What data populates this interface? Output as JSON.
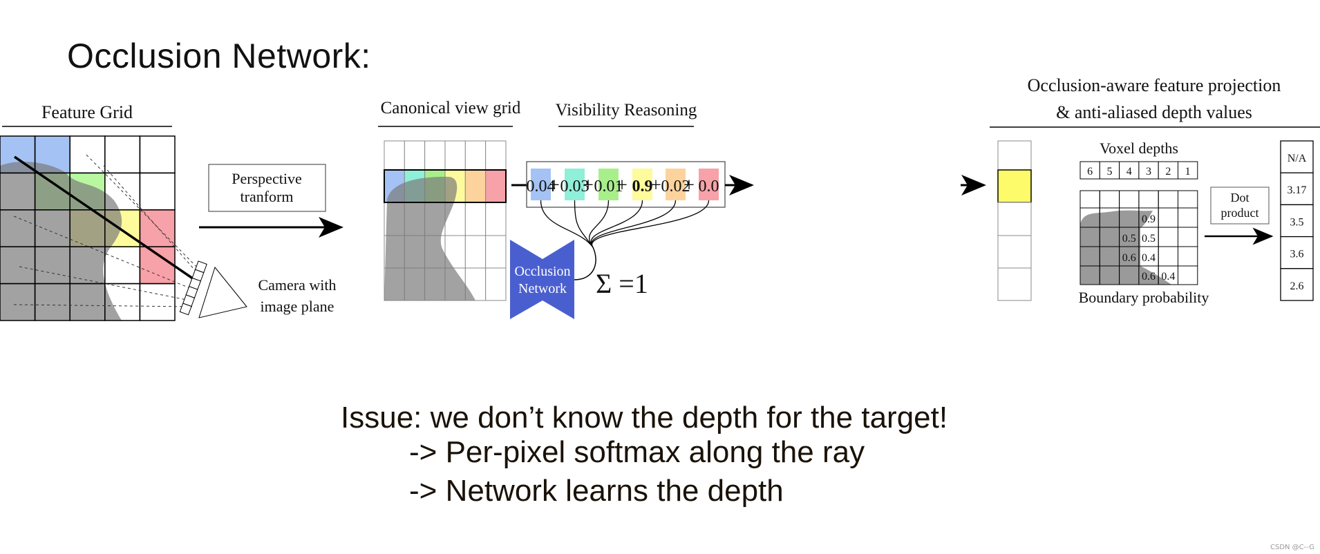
{
  "slide": {
    "title": "Occlusion Network:"
  },
  "diagram": {
    "feature_grid": {
      "title": "Feature Grid"
    },
    "perspective": {
      "line1": "Perspective",
      "line2": "tranform"
    },
    "camera": {
      "line1": "Camera with",
      "line2": "image plane"
    },
    "canonical": {
      "title": "Canonical view grid",
      "row_colors": [
        "#a4c2f4",
        "#8fefd8",
        "#a8ef8c",
        "#fdfb9c",
        "#fcd39c",
        "#f7a1a8"
      ]
    },
    "visibility": {
      "title": "Visibility Reasoning",
      "values": [
        "0.04",
        "0.03",
        "0.01",
        "0.9",
        "0.02",
        "0.0"
      ],
      "operator": "+",
      "sum_label": "Σ =1"
    },
    "network": {
      "line1": "Occlusion",
      "line2": "Network",
      "color": "#4a5fcf"
    },
    "projection": {
      "title_line1": "Occlusion-aware feature projection",
      "title_line2": "& anti-aliased depth values",
      "voxel_label": "Voxel depths",
      "voxel_depths": [
        "6",
        "5",
        "4",
        "3",
        "2",
        "1"
      ],
      "boundary_label": "Boundary probability",
      "probabilities": [
        [
          "",
          "",
          "",
          "",
          "",
          ""
        ],
        [
          "",
          "",
          "",
          "0.9",
          "",
          ""
        ],
        [
          "",
          "",
          "0.5",
          "0.5",
          "",
          ""
        ],
        [
          "",
          "",
          "0.6",
          "0.4",
          "",
          ""
        ],
        [
          "",
          "",
          "",
          "0.6",
          "0.4",
          ""
        ]
      ],
      "dot_line1": "Dot",
      "dot_line2": "product",
      "depth_values": [
        "N/A",
        "3.17",
        "3.5",
        "3.6",
        "2.6"
      ]
    }
  },
  "issue": {
    "line1": "Issue: we don’t know the depth for the target!",
    "line2": "-> Per-pixel softmax along the ray",
    "line3": "-> Network learns the depth"
  },
  "watermark": "CSDN @C--G"
}
